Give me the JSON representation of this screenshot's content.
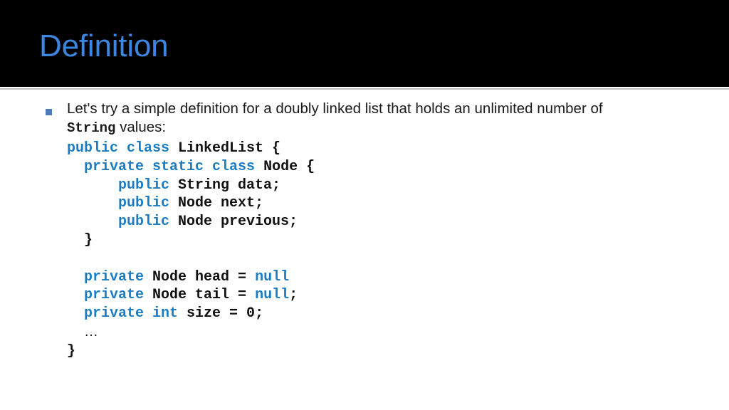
{
  "slide": {
    "title": "Definition",
    "title_color": "#3d86e0",
    "header_background": "#000000",
    "background": "#ffffff",
    "divider_color": "#c9c9c9"
  },
  "bullet": {
    "marker": "square-bullet",
    "marker_color": "#4f7cb8",
    "text_part1": "Let's try a simple definition for a doubly linked list that holds an unlimited number of ",
    "text_mono": "String",
    "text_part2": " values:"
  },
  "code": {
    "keyword_color": "#1a7dc4",
    "plain_color": "#111111",
    "lines": [
      {
        "indent": "",
        "tokens": [
          {
            "t": "public class ",
            "k": true
          },
          {
            "t": "LinkedList {",
            "k": false
          }
        ]
      },
      {
        "indent": "  ",
        "tokens": [
          {
            "t": "private static class ",
            "k": true
          },
          {
            "t": "Node {",
            "k": false
          }
        ]
      },
      {
        "indent": "      ",
        "tokens": [
          {
            "t": "public ",
            "k": true
          },
          {
            "t": "String data;",
            "k": false
          }
        ]
      },
      {
        "indent": "      ",
        "tokens": [
          {
            "t": "public ",
            "k": true
          },
          {
            "t": "Node next;",
            "k": false
          }
        ]
      },
      {
        "indent": "      ",
        "tokens": [
          {
            "t": "public ",
            "k": true
          },
          {
            "t": "Node previous;",
            "k": false
          }
        ]
      },
      {
        "indent": "  ",
        "tokens": [
          {
            "t": "}",
            "k": false
          }
        ]
      },
      {
        "indent": "",
        "tokens": [
          {
            "t": " ",
            "k": false
          }
        ]
      },
      {
        "indent": "  ",
        "tokens": [
          {
            "t": "private ",
            "k": true
          },
          {
            "t": "Node head = ",
            "k": false
          },
          {
            "t": "null",
            "k": true
          }
        ]
      },
      {
        "indent": "  ",
        "tokens": [
          {
            "t": "private ",
            "k": true
          },
          {
            "t": "Node tail = ",
            "k": false
          },
          {
            "t": "null",
            "k": true
          },
          {
            "t": ";",
            "k": false
          }
        ]
      },
      {
        "indent": "  ",
        "tokens": [
          {
            "t": "private int ",
            "k": true
          },
          {
            "t": "size = 0;",
            "k": false
          }
        ]
      },
      {
        "indent": "  ",
        "tokens": [
          {
            "t": "…",
            "k": false
          }
        ]
      },
      {
        "indent": "",
        "tokens": [
          {
            "t": "}",
            "k": false
          }
        ]
      }
    ]
  }
}
